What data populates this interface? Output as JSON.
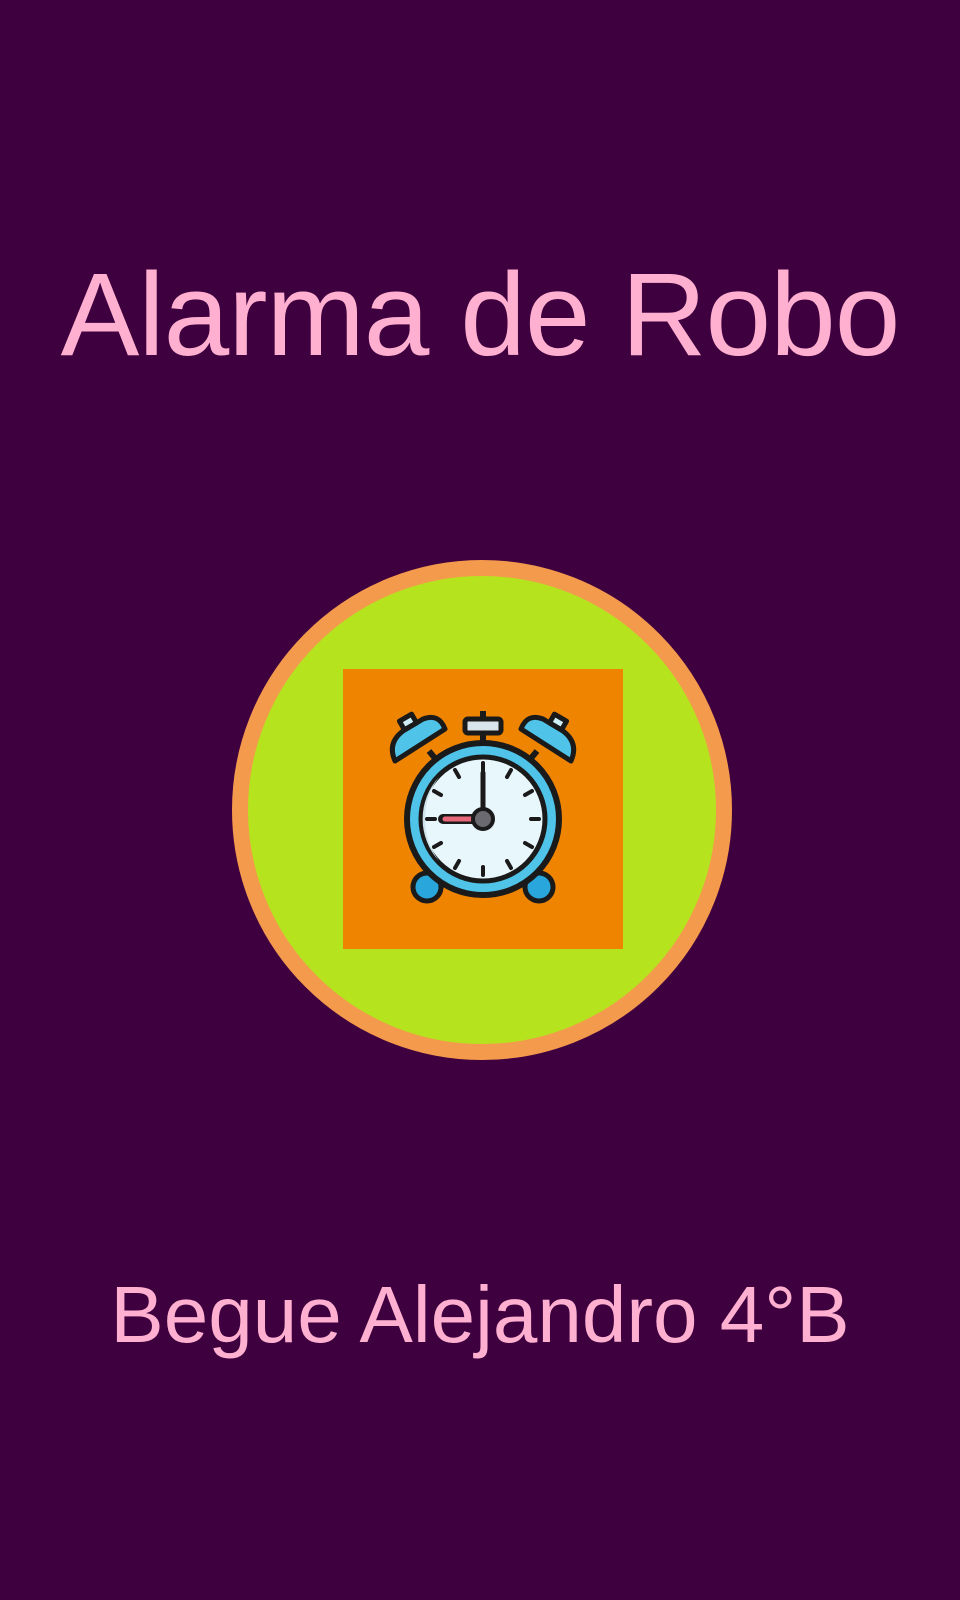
{
  "screen": {
    "title": "Alarma de Robo",
    "author": "Begue Alejandro 4°B"
  },
  "alarm_button": {
    "icon": "alarm-clock-icon"
  },
  "colors": {
    "background": "#3f003f",
    "text": "#ffb0d0",
    "button_fill": "#b5e41e",
    "button_ring": "#f49a4c",
    "icon_tile": "#ef8400",
    "clock_blue": "#4fc3e8"
  }
}
